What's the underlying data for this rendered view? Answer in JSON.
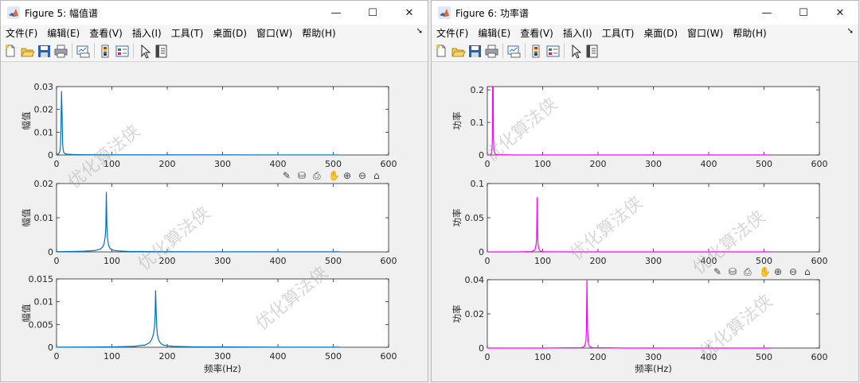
{
  "colors": {
    "mag": "#0072bd",
    "pow": "#ff00ff"
  },
  "menu_items": [
    "文件(F)",
    "编辑(E)",
    "查看(V)",
    "插入(I)",
    "工具(T)",
    "桌面(D)",
    "窗口(W)",
    "帮助(H)"
  ],
  "toolbar_icons": [
    "new-figure-icon",
    "open-file-icon",
    "save-icon",
    "print-icon",
    "link-plot-icon",
    "insert-colorbar-icon",
    "insert-legend-icon",
    "edit-plot-arrow-icon",
    "property-inspector-icon"
  ],
  "axes_toolbar_icons": [
    "brush-icon",
    "data-tips-icon",
    "export-icon",
    "pan-hand-icon",
    "zoom-in-icon",
    "zoom-out-icon",
    "restore-view-icon"
  ],
  "watermark": "优化算法侠",
  "windows": [
    {
      "title": "Figure 5: 幅值谱",
      "xlabel": "频率(Hz)",
      "ylabel": "幅值",
      "xticks": [
        "0",
        "100",
        "200",
        "300",
        "400",
        "500",
        "600"
      ]
    },
    {
      "title": "Figure 6: 功率谱",
      "xlabel": "频率(Hz)",
      "ylabel": "功率",
      "xticks": [
        "0",
        "100",
        "200",
        "300",
        "400",
        "500",
        "600"
      ]
    }
  ],
  "chart_data": [
    {
      "type": "line",
      "figure": "Figure 5: 幅值谱",
      "ylabel": "幅值",
      "xlim": [
        0,
        600
      ],
      "ylim": [
        0,
        0.03
      ],
      "yticks": [
        "0",
        "0.01",
        "0.02",
        "0.03"
      ],
      "series": [
        {
          "x": [
            0,
            2,
            4,
            6,
            7,
            8,
            9,
            10,
            11,
            12,
            13,
            14,
            15,
            16,
            18,
            20,
            30,
            50,
            100,
            200,
            300,
            400,
            450,
            500,
            512
          ],
          "y": [
            0,
            0.0003,
            0.0006,
            0.0015,
            0.004,
            0.012,
            0.028,
            0.018,
            0.005,
            0.0022,
            0.0012,
            0.0008,
            0.0006,
            0.0005,
            0.0004,
            0.0003,
            0.0002,
            0.0001,
            6e-05,
            4e-05,
            3e-05,
            2e-05,
            2e-05,
            2e-05,
            2e-05
          ]
        }
      ]
    },
    {
      "type": "line",
      "figure": "Figure 5: 幅值谱",
      "ylabel": "幅值",
      "xlim": [
        0,
        600
      ],
      "ylim": [
        0,
        0.02
      ],
      "yticks": [
        "0",
        "0.01",
        "0.02"
      ],
      "series": [
        {
          "x": [
            0,
            20,
            50,
            70,
            80,
            84,
            86,
            88,
            89,
            90,
            91,
            92,
            94,
            96,
            98,
            100,
            105,
            110,
            130,
            200,
            300,
            400,
            500,
            512
          ],
          "y": [
            5e-05,
            0.0001,
            0.0002,
            0.0004,
            0.0009,
            0.0016,
            0.0025,
            0.0045,
            0.007,
            0.0175,
            0.0075,
            0.0042,
            0.002,
            0.0012,
            0.0008,
            0.0006,
            0.0004,
            0.0003,
            0.00015,
            6e-05,
            4e-05,
            3e-05,
            2e-05,
            2e-05
          ]
        }
      ]
    },
    {
      "type": "line",
      "figure": "Figure 5: 幅值谱",
      "ylabel": "幅值",
      "xlabel": "频率(Hz)",
      "xlim": [
        0,
        600
      ],
      "ylim": [
        0,
        0.015
      ],
      "yticks": [
        "0",
        "0.005",
        "0.01",
        "0.015"
      ],
      "series": [
        {
          "x": [
            0,
            50,
            100,
            140,
            160,
            168,
            172,
            175,
            177,
            178,
            179,
            180,
            181,
            182,
            184,
            186,
            190,
            195,
            210,
            250,
            300,
            400,
            500,
            512
          ],
          "y": [
            2e-05,
            4e-05,
            8e-05,
            0.0002,
            0.0005,
            0.001,
            0.0017,
            0.0028,
            0.0045,
            0.0065,
            0.0125,
            0.008,
            0.0045,
            0.003,
            0.0018,
            0.0012,
            0.0007,
            0.0004,
            0.0002,
            0.0001,
            6e-05,
            3e-05,
            2e-05,
            2e-05
          ]
        }
      ]
    },
    {
      "type": "line",
      "figure": "Figure 6: 功率谱",
      "ylabel": "功率",
      "xlim": [
        0,
        600
      ],
      "ylim": [
        0,
        0.21
      ],
      "yticks": [
        "0",
        "0.1",
        "0.2"
      ],
      "series": [
        {
          "x": [
            0,
            5,
            7,
            8,
            9,
            9.5,
            10,
            10.5,
            11,
            12,
            14,
            16,
            20,
            50,
            100,
            200,
            300,
            400,
            500,
            512
          ],
          "y": [
            0,
            0.0005,
            0.003,
            0.01,
            0.04,
            0.21,
            0.21,
            0.21,
            0.05,
            0.012,
            0.004,
            0.002,
            0.001,
            0,
            0,
            0,
            0,
            0,
            0,
            0
          ]
        }
      ]
    },
    {
      "type": "line",
      "figure": "Figure 6: 功率谱",
      "ylabel": "功率",
      "xlim": [
        0,
        600
      ],
      "ylim": [
        0,
        0.1
      ],
      "yticks": [
        "0",
        "0.05",
        "0.1"
      ],
      "series": [
        {
          "x": [
            0,
            50,
            80,
            86,
            88,
            89,
            90,
            91,
            92,
            94,
            96,
            100,
            150,
            200,
            300,
            400,
            500,
            512
          ],
          "y": [
            0,
            0,
            0.0005,
            0.003,
            0.01,
            0.02,
            0.08,
            0.02,
            0.008,
            0.003,
            0.001,
            0.0003,
            0,
            0,
            0,
            0,
            0,
            0
          ]
        }
      ]
    },
    {
      "type": "line",
      "figure": "Figure 6: 功率谱",
      "ylabel": "功率",
      "xlim": [
        0,
        600
      ],
      "ylim": [
        0,
        0.04
      ],
      "yticks": [
        "0",
        "0.02",
        "0.04"
      ],
      "series": [
        {
          "x": [
            0,
            100,
            170,
            176,
            178,
            179,
            180,
            181,
            182,
            184,
            190,
            250,
            300,
            400,
            500,
            512
          ],
          "y": [
            0,
            0,
            0.0002,
            0.001,
            0.004,
            0.01,
            0.04,
            0.012,
            0.004,
            0.001,
            0.0002,
            0,
            0,
            0,
            0,
            0
          ]
        }
      ]
    }
  ]
}
